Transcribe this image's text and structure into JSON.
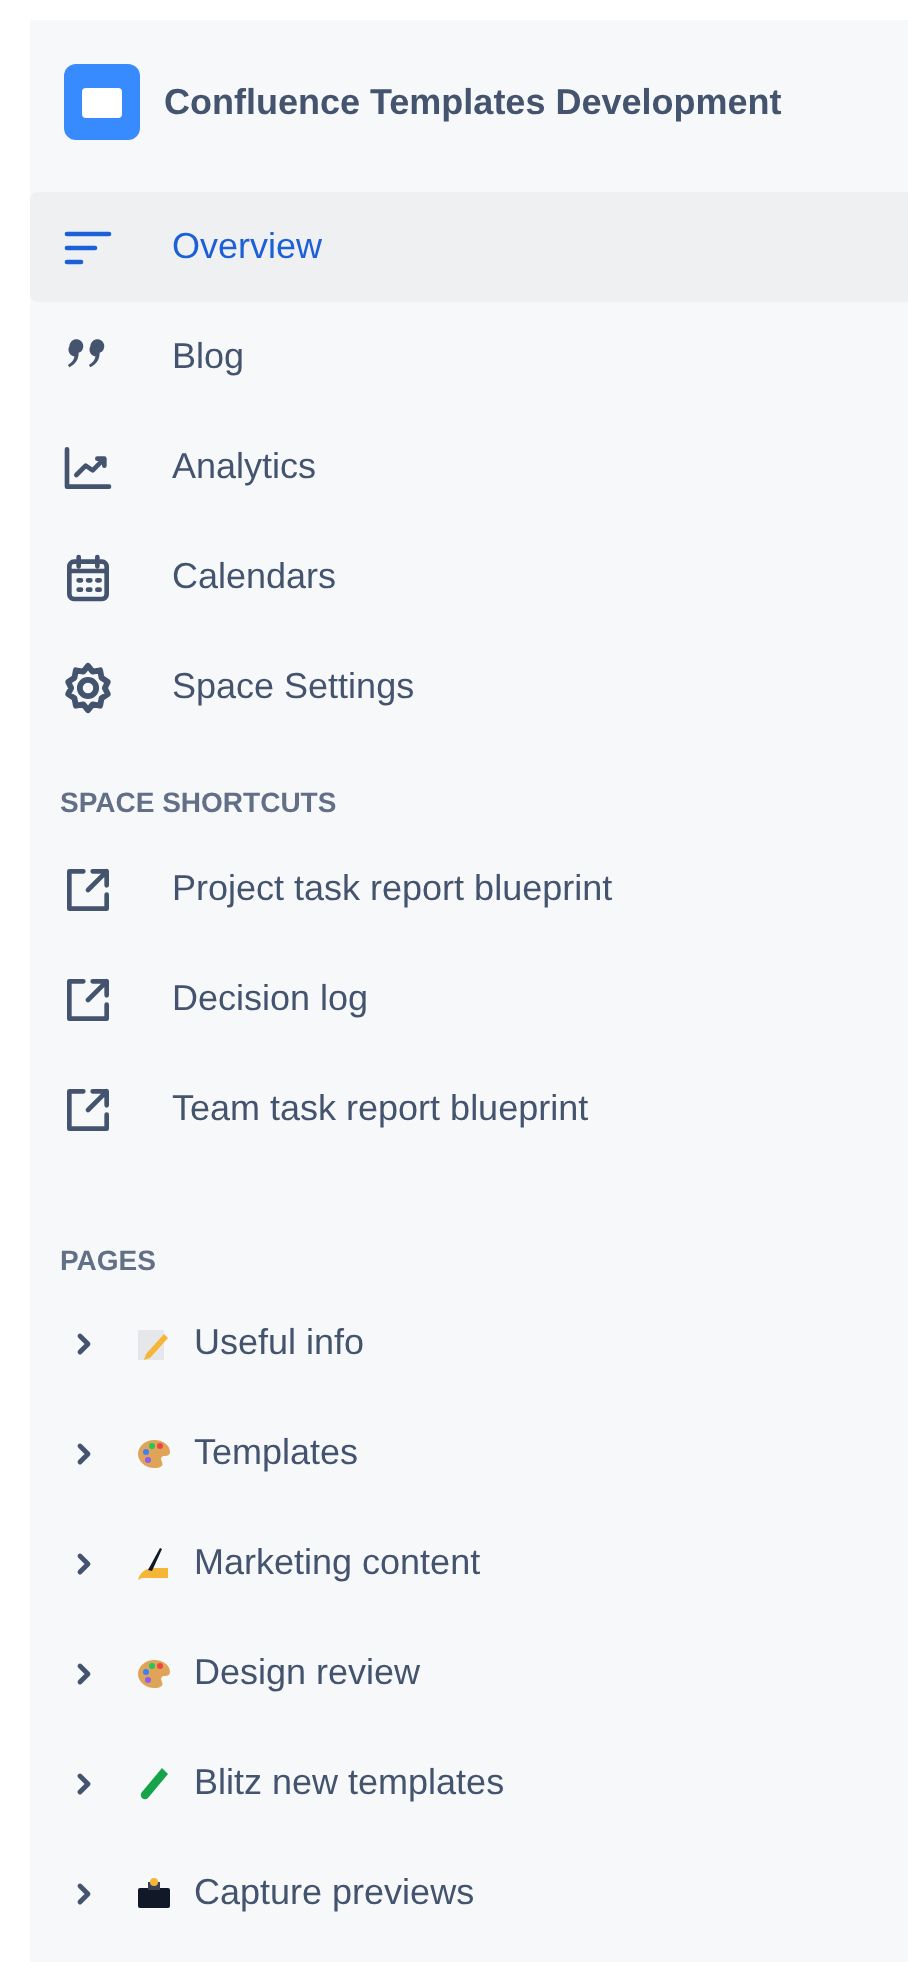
{
  "space": {
    "title": "Confluence Templates Development"
  },
  "nav": [
    {
      "label": "Overview",
      "kind": "overview",
      "selected": true
    },
    {
      "label": "Blog",
      "kind": "quote",
      "selected": false
    },
    {
      "label": "Analytics",
      "kind": "chart",
      "selected": false
    },
    {
      "label": "Calendars",
      "kind": "calendar",
      "selected": false
    },
    {
      "label": "Space Settings",
      "kind": "gear",
      "selected": false
    }
  ],
  "shortcuts": {
    "heading": "SPACE SHORTCUTS",
    "items": [
      {
        "label": "Project task report blueprint"
      },
      {
        "label": "Decision log"
      },
      {
        "label": "Team task report blueprint"
      }
    ]
  },
  "pages": {
    "heading": "PAGES",
    "items": [
      {
        "label": "Useful info",
        "kind": "memo",
        "expanded": false
      },
      {
        "label": "Templates",
        "kind": "palette",
        "expanded": false
      },
      {
        "label": "Marketing content",
        "kind": "writing",
        "expanded": false
      },
      {
        "label": "Design review",
        "kind": "palette",
        "expanded": false
      },
      {
        "label": "Blitz new templates",
        "kind": "tube",
        "expanded": false
      },
      {
        "label": "Capture previews",
        "kind": "camera",
        "expanded": false
      }
    ]
  }
}
